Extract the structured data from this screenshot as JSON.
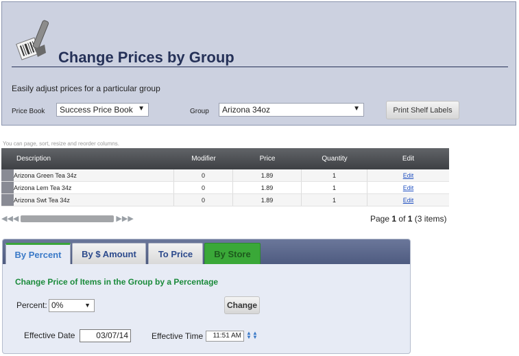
{
  "header": {
    "title": "Change Prices by Group",
    "subtitle": "Easily adjust prices for a particular group",
    "price_book_label": "Price Book",
    "price_book_value": "Success Price Book",
    "group_label": "Group",
    "group_value": "Arizona 34oz",
    "print_button": "Print Shelf Labels"
  },
  "grid": {
    "hint": "You can page, sort, resize and reorder columns.",
    "columns": [
      "Description",
      "Modifier",
      "Price",
      "Quantity",
      "Edit"
    ],
    "rows": [
      {
        "description": "Arizona Green Tea 34z",
        "modifier": "0",
        "price": "1.89",
        "quantity": "1",
        "edit": "Edit"
      },
      {
        "description": "Arizona Lem Tea 34z",
        "modifier": "0",
        "price": "1.89",
        "quantity": "1",
        "edit": "Edit"
      },
      {
        "description": "Arizona Swt Tea 34z",
        "modifier": "0",
        "price": "1.89",
        "quantity": "1",
        "edit": "Edit"
      }
    ],
    "pager": {
      "prefix": "Page",
      "current": "1",
      "of_label": "of",
      "total": "1",
      "items": "(3 items)"
    }
  },
  "tabs": {
    "items": [
      {
        "label": "By Percent"
      },
      {
        "label": "By $ Amount"
      },
      {
        "label": "To Price"
      },
      {
        "label": "By Store"
      }
    ]
  },
  "form": {
    "heading": "Change Price of Items in the Group by a Percentage",
    "percent_label": "Percent:",
    "percent_value": "0%",
    "change_button": "Change",
    "effective_date_label": "Effective Date",
    "effective_date_value": "03/07/14",
    "effective_time_label": "Effective Time",
    "effective_time_value": "11:51 AM"
  },
  "colors": {
    "title": "#253158",
    "heading_green": "#1a8a3a",
    "tab_store_green": "#3aa838",
    "link_blue": "#1f4fc0"
  }
}
